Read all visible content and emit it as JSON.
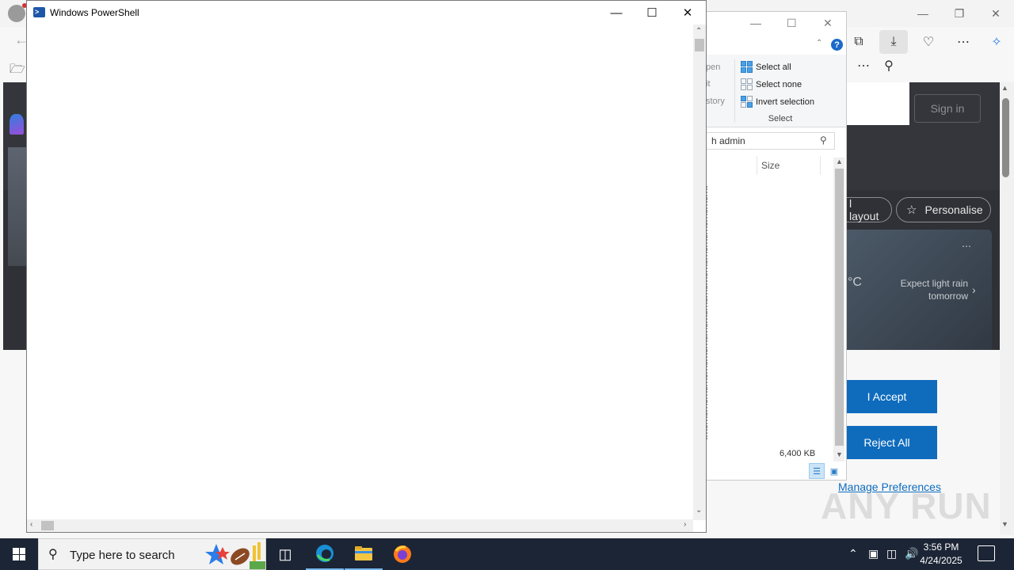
{
  "powershell": {
    "title": "Windows PowerShell"
  },
  "explorer": {
    "ribbon_left": [
      "pen",
      "it",
      "story"
    ],
    "select_all": "Select all",
    "select_none": "Select none",
    "invert_selection": "Invert selection",
    "select_group": "Select",
    "search_text": "h admin",
    "size_column": "Size",
    "file_size": "6,400 KB"
  },
  "browser": {
    "sign_in": "Sign in",
    "layout_pill": "l layout",
    "personalise_pill": "Personalise",
    "weather_temp": "°C",
    "weather_text": "Expect light rain tomorrow",
    "accept_button": "I Accept",
    "reject_button": "Reject All",
    "manage_link": "Manage Preferences"
  },
  "watermark": "ANY RUN",
  "taskbar": {
    "search_placeholder": "Type here to search",
    "time": "3:56 PM",
    "date": "4/24/2025"
  },
  "colors": {
    "taskbar": "#1c2535",
    "accent_blue": "#0f6cbd",
    "msn_dark": "#2f3136"
  }
}
